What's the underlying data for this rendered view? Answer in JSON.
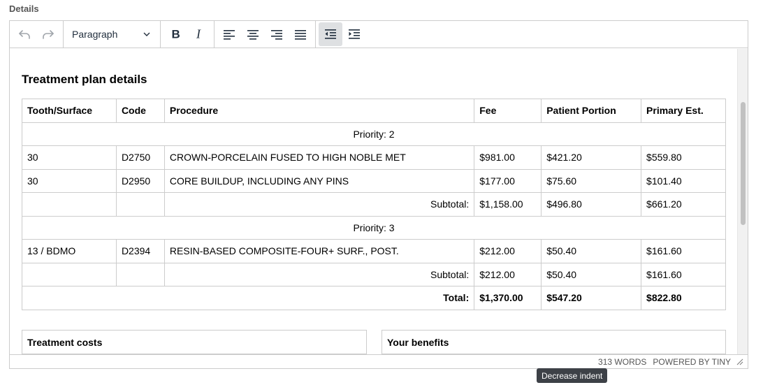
{
  "field": {
    "label": "Details"
  },
  "toolbar": {
    "block_format": "Paragraph",
    "buttons": [
      {
        "name": "undo",
        "icon": "undo-icon",
        "state": "disabled"
      },
      {
        "name": "redo",
        "icon": "redo-icon",
        "state": "disabled"
      },
      {
        "name": "bold",
        "icon": "bold-icon"
      },
      {
        "name": "italic",
        "icon": "italic-icon"
      },
      {
        "name": "align-left",
        "icon": "align-left-icon"
      },
      {
        "name": "align-center",
        "icon": "align-center-icon"
      },
      {
        "name": "align-right",
        "icon": "align-right-icon"
      },
      {
        "name": "justify",
        "icon": "align-justify-icon"
      },
      {
        "name": "outdent",
        "icon": "outdent-icon",
        "state": "active"
      },
      {
        "name": "indent",
        "icon": "indent-icon"
      }
    ]
  },
  "content": {
    "title": "Treatment plan details",
    "table": {
      "headers": [
        "Tooth/Surface",
        "Code",
        "Procedure",
        "Fee",
        "Patient Portion",
        "Primary Est."
      ],
      "priority_2_label": "Priority: 2",
      "rows_p2": [
        [
          "30",
          "D2750",
          "CROWN-PORCELAIN FUSED TO HIGH NOBLE MET",
          "$981.00",
          "$421.20",
          "$559.80"
        ],
        [
          "30",
          "D2950",
          "CORE BUILDUP, INCLUDING ANY PINS",
          "$177.00",
          "$75.60",
          "$101.40"
        ]
      ],
      "subtotal_p2": {
        "label": "Subtotal:",
        "fee": "$1,158.00",
        "patient": "$496.80",
        "primary": "$661.20"
      },
      "priority_3_label": "Priority: 3",
      "rows_p3": [
        [
          "13 / BDMO",
          "D2394",
          "RESIN-BASED COMPOSITE-FOUR+ SURF., POST.",
          "$212.00",
          "$50.40",
          "$161.60"
        ]
      ],
      "subtotal_p3": {
        "label": "Subtotal:",
        "fee": "$212.00",
        "patient": "$50.40",
        "primary": "$161.60"
      },
      "total": {
        "label": "Total:",
        "fee": "$1,370.00",
        "patient": "$547.20",
        "primary": "$822.80"
      }
    },
    "treatment_costs_header": "Treatment costs",
    "your_benefits_header": "Your benefits"
  },
  "statusbar": {
    "word_count": "313 WORDS",
    "powered_by": "POWERED BY TINY"
  },
  "tooltip": {
    "text": "Decrease indent"
  },
  "colors": {
    "border": "#cccccc",
    "active_button": "#dee0e2",
    "tooltip_bg": "#3d4147"
  }
}
